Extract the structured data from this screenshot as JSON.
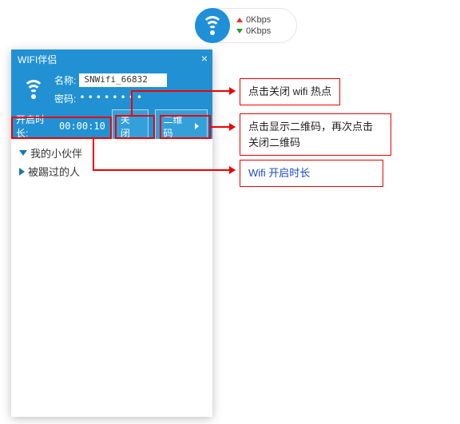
{
  "pill": {
    "up": "0Kbps",
    "down": "0Kbps"
  },
  "window": {
    "title": "WIFI伴侣",
    "name_label": "名称:",
    "ssid": "SNWifi_66832",
    "pwd_label": "密码:",
    "pwd_masked": "••••••••",
    "uptime_label": "开启时长:",
    "uptime_value": "00:00:10",
    "btn_close": "关闭",
    "btn_qr": "二维码"
  },
  "tree": {
    "item1": "我的小伙伴",
    "item2": "被踢过的人"
  },
  "annotations": {
    "a1": "点击关闭 wifi 热点",
    "a2": "点击显示二维码，再次点击关闭二维码",
    "a3": "Wifi 开启时长"
  }
}
